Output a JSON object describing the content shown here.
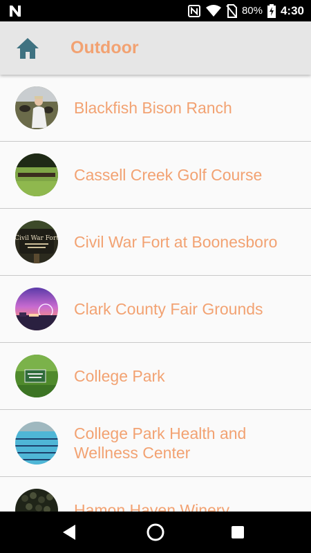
{
  "status_bar": {
    "battery_percent": "80%",
    "time": "4:30",
    "icons": [
      "n-logo-icon",
      "nfc-icon",
      "wifi-icon",
      "no-sim-icon",
      "battery-charging-icon"
    ]
  },
  "app_bar": {
    "title": "Outdoor",
    "home_icon": "home-icon"
  },
  "colors": {
    "accent": "#f2a272",
    "home_icon": "#3f7281",
    "app_bar_bg": "#e6e6e6",
    "divider": "#c8c8c8"
  },
  "items": [
    {
      "label": "Blackfish Bison Ranch",
      "thumb": "bison-ranch-photo"
    },
    {
      "label": "Cassell Creek Golf Course",
      "thumb": "golf-course-photo"
    },
    {
      "label": "Civil War Fort at Boonesboro",
      "thumb": "civil-war-fort-sign-photo"
    },
    {
      "label": "Clark County Fair Grounds",
      "thumb": "fair-grounds-sunset-photo"
    },
    {
      "label": "College Park",
      "thumb": "college-park-sign-photo"
    },
    {
      "label": "College Park Health and Wellness Center",
      "thumb": "swimming-pool-photo"
    },
    {
      "label": "Hamon Haven Winery",
      "thumb": "grapes-photo"
    }
  ],
  "nav_bar": {
    "buttons": [
      "back-icon",
      "home-circle-icon",
      "recents-icon"
    ]
  }
}
